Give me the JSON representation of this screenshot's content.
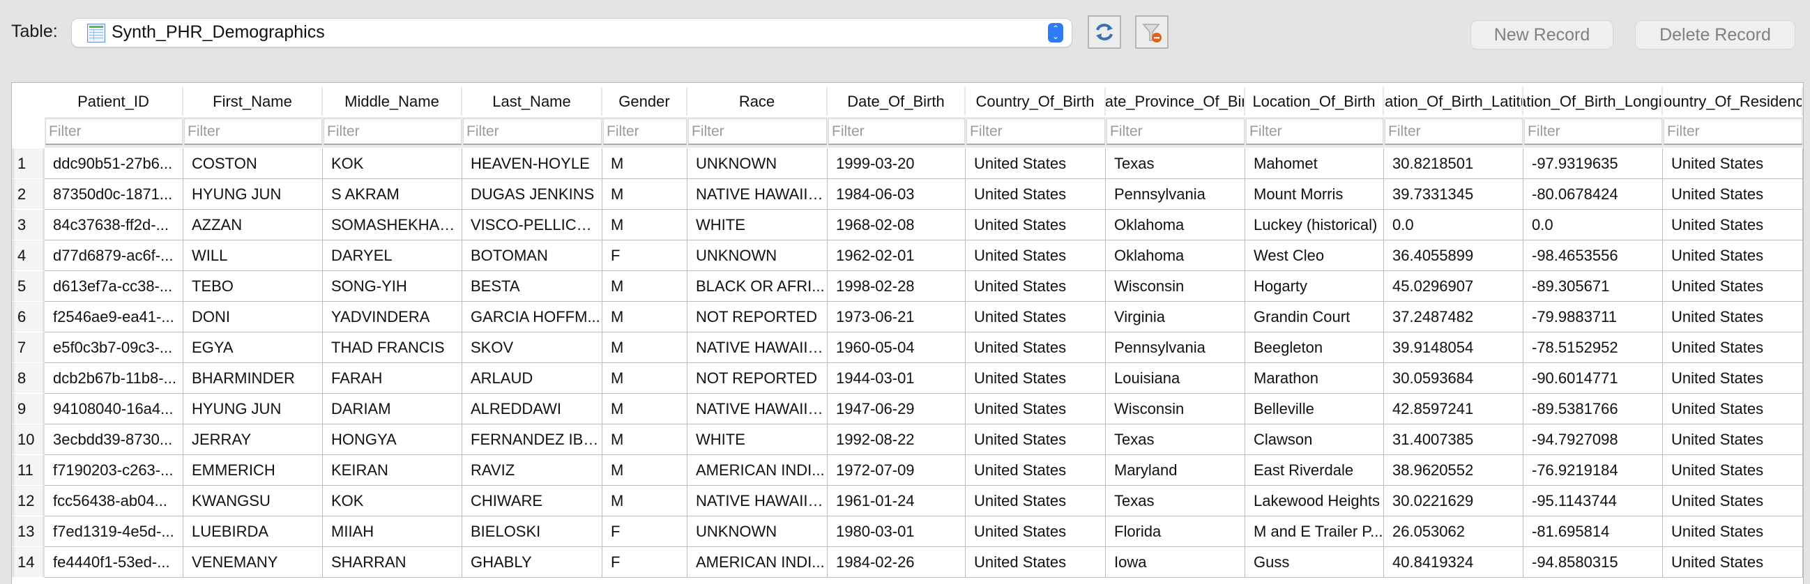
{
  "toolbar": {
    "table_label": "Table:",
    "selected_table": "Synth_PHR_Demographics",
    "refresh_icon": "refresh-icon",
    "clear_filter_icon": "filter-clear-icon",
    "new_record_label": "New Record",
    "delete_record_label": "Delete Record"
  },
  "grid": {
    "filter_placeholder": "Filter",
    "columns": [
      "Patient_ID",
      "First_Name",
      "Middle_Name",
      "Last_Name",
      "Gender",
      "Race",
      "Date_Of_Birth",
      "Country_Of_Birth",
      "State_Province_Of_Birth",
      "Location_Of_Birth",
      "Location_Of_Birth_Latitude",
      "Location_Of_Birth_Longitude",
      "Country_Of_Residence"
    ],
    "rows": [
      {
        "n": "1",
        "c": [
          "ddc90b51-27b6...",
          "COSTON",
          "KOK",
          "HEAVEN-HOYLE",
          "M",
          "UNKNOWN",
          "1999-03-20",
          "United States",
          "Texas",
          "Mahomet",
          "30.8218501",
          "-97.9319635",
          "United States"
        ]
      },
      {
        "n": "2",
        "c": [
          "87350d0c-1871...",
          "HYUNG JUN",
          "S AKRAM",
          "DUGAS JENKINS",
          "M",
          "NATIVE HAWAIIA...",
          "1984-06-03",
          "United States",
          "Pennsylvania",
          "Mount Morris",
          "39.7331345",
          "-80.0678424",
          "United States"
        ]
      },
      {
        "n": "3",
        "c": [
          "84c37638-ff2d-...",
          "AZZAN",
          "SOMASHEKHAR...",
          "VISCO-PELLICCIO",
          "M",
          "WHITE",
          "1968-02-08",
          "United States",
          "Oklahoma",
          "Luckey (historical)",
          "0.0",
          "0.0",
          "United States"
        ]
      },
      {
        "n": "4",
        "c": [
          "d77d6879-ac6f-...",
          "WILL",
          "DARYEL",
          "BOTOMAN",
          "F",
          "UNKNOWN",
          "1962-02-01",
          "United States",
          "Oklahoma",
          "West Cleo",
          "36.4055899",
          "-98.4653556",
          "United States"
        ]
      },
      {
        "n": "5",
        "c": [
          "d613ef7a-cc38-...",
          "TEBO",
          "SONG-YIH",
          "BESTA",
          "M",
          "BLACK OR AFRI...",
          "1998-02-28",
          "United States",
          "Wisconsin",
          "Hogarty",
          "45.0296907",
          "-89.305671",
          "United States"
        ]
      },
      {
        "n": "6",
        "c": [
          "f2546ae9-ea41-...",
          "DONI",
          "YADVINDERA",
          "GARCIA HOFFM...",
          "M",
          "NOT REPORTED",
          "1973-06-21",
          "United States",
          "Virginia",
          "Grandin Court",
          "37.2487482",
          "-79.9883711",
          "United States"
        ]
      },
      {
        "n": "7",
        "c": [
          "e5f0c3b7-09c3-...",
          "EGYA",
          "THAD FRANCIS",
          "SKOV",
          "M",
          "NATIVE HAWAIIA...",
          "1960-05-04",
          "United States",
          "Pennsylvania",
          "Beegleton",
          "39.9148054",
          "-78.5152952",
          "United States"
        ]
      },
      {
        "n": "8",
        "c": [
          "dcb2b67b-11b8-...",
          "BHARMINDER",
          "FARAH",
          "ARLAUD",
          "M",
          "NOT REPORTED",
          "1944-03-01",
          "United States",
          "Louisiana",
          "Marathon",
          "30.0593684",
          "-90.6014771",
          "United States"
        ]
      },
      {
        "n": "9",
        "c": [
          "94108040-16a4...",
          "HYUNG JUN",
          "DARIAM",
          "ALREDDAWI",
          "M",
          "NATIVE HAWAIIA...",
          "1947-06-29",
          "United States",
          "Wisconsin",
          "Belleville",
          "42.8597241",
          "-89.5381766",
          "United States"
        ]
      },
      {
        "n": "10",
        "c": [
          "3ecbdd39-8730...",
          "JERRAY",
          "HONGYA",
          "FERNANDEZ IBA...",
          "M",
          "WHITE",
          "1992-08-22",
          "United States",
          "Texas",
          "Clawson",
          "31.4007385",
          "-94.7927098",
          "United States"
        ]
      },
      {
        "n": "11",
        "c": [
          "f7190203-c263-...",
          "EMMERICH",
          "KEIRAN",
          "RAVIZ",
          "M",
          "AMERICAN INDI...",
          "1972-07-09",
          "United States",
          "Maryland",
          "East Riverdale",
          "38.9620552",
          "-76.9219184",
          "United States"
        ]
      },
      {
        "n": "12",
        "c": [
          "fcc56438-ab04...",
          "KWANGSU",
          "KOK",
          "CHIWARE",
          "M",
          "NATIVE HAWAIIA...",
          "1961-01-24",
          "United States",
          "Texas",
          "Lakewood Heights",
          "30.0221629",
          "-95.1143744",
          "United States"
        ]
      },
      {
        "n": "13",
        "c": [
          "f7ed1319-4e5d-...",
          "LUEBIRDA",
          "MIIAH",
          "BIELOSKI",
          "F",
          "UNKNOWN",
          "1980-03-01",
          "United States",
          "Florida",
          "M and E Trailer P...",
          "26.053062",
          "-81.695814",
          "United States"
        ]
      },
      {
        "n": "14",
        "c": [
          "fe4440f1-53ed-...",
          "VENEMANY",
          "SHARRAN",
          "GHABLY",
          "F",
          "AMERICAN INDI...",
          "1984-02-26",
          "United States",
          "Iowa",
          "Guss",
          "40.8419324",
          "-94.8580315",
          "United States"
        ]
      }
    ]
  }
}
